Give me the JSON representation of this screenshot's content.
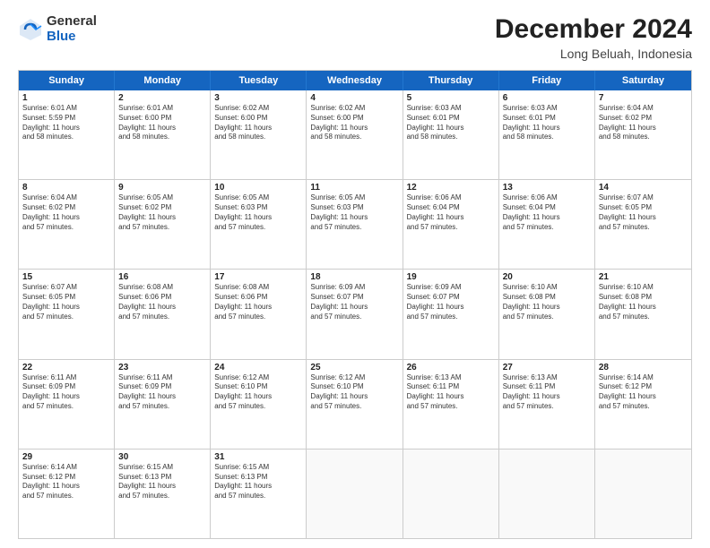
{
  "logo": {
    "general": "General",
    "blue": "Blue"
  },
  "title": "December 2024",
  "subtitle": "Long Beluah, Indonesia",
  "header_days": [
    "Sunday",
    "Monday",
    "Tuesday",
    "Wednesday",
    "Thursday",
    "Friday",
    "Saturday"
  ],
  "weeks": [
    [
      {
        "day": "1",
        "info": "Sunrise: 6:01 AM\nSunset: 5:59 PM\nDaylight: 11 hours\nand 58 minutes."
      },
      {
        "day": "2",
        "info": "Sunrise: 6:01 AM\nSunset: 6:00 PM\nDaylight: 11 hours\nand 58 minutes."
      },
      {
        "day": "3",
        "info": "Sunrise: 6:02 AM\nSunset: 6:00 PM\nDaylight: 11 hours\nand 58 minutes."
      },
      {
        "day": "4",
        "info": "Sunrise: 6:02 AM\nSunset: 6:00 PM\nDaylight: 11 hours\nand 58 minutes."
      },
      {
        "day": "5",
        "info": "Sunrise: 6:03 AM\nSunset: 6:01 PM\nDaylight: 11 hours\nand 58 minutes."
      },
      {
        "day": "6",
        "info": "Sunrise: 6:03 AM\nSunset: 6:01 PM\nDaylight: 11 hours\nand 58 minutes."
      },
      {
        "day": "7",
        "info": "Sunrise: 6:04 AM\nSunset: 6:02 PM\nDaylight: 11 hours\nand 58 minutes."
      }
    ],
    [
      {
        "day": "8",
        "info": "Sunrise: 6:04 AM\nSunset: 6:02 PM\nDaylight: 11 hours\nand 57 minutes."
      },
      {
        "day": "9",
        "info": "Sunrise: 6:05 AM\nSunset: 6:02 PM\nDaylight: 11 hours\nand 57 minutes."
      },
      {
        "day": "10",
        "info": "Sunrise: 6:05 AM\nSunset: 6:03 PM\nDaylight: 11 hours\nand 57 minutes."
      },
      {
        "day": "11",
        "info": "Sunrise: 6:05 AM\nSunset: 6:03 PM\nDaylight: 11 hours\nand 57 minutes."
      },
      {
        "day": "12",
        "info": "Sunrise: 6:06 AM\nSunset: 6:04 PM\nDaylight: 11 hours\nand 57 minutes."
      },
      {
        "day": "13",
        "info": "Sunrise: 6:06 AM\nSunset: 6:04 PM\nDaylight: 11 hours\nand 57 minutes."
      },
      {
        "day": "14",
        "info": "Sunrise: 6:07 AM\nSunset: 6:05 PM\nDaylight: 11 hours\nand 57 minutes."
      }
    ],
    [
      {
        "day": "15",
        "info": "Sunrise: 6:07 AM\nSunset: 6:05 PM\nDaylight: 11 hours\nand 57 minutes."
      },
      {
        "day": "16",
        "info": "Sunrise: 6:08 AM\nSunset: 6:06 PM\nDaylight: 11 hours\nand 57 minutes."
      },
      {
        "day": "17",
        "info": "Sunrise: 6:08 AM\nSunset: 6:06 PM\nDaylight: 11 hours\nand 57 minutes."
      },
      {
        "day": "18",
        "info": "Sunrise: 6:09 AM\nSunset: 6:07 PM\nDaylight: 11 hours\nand 57 minutes."
      },
      {
        "day": "19",
        "info": "Sunrise: 6:09 AM\nSunset: 6:07 PM\nDaylight: 11 hours\nand 57 minutes."
      },
      {
        "day": "20",
        "info": "Sunrise: 6:10 AM\nSunset: 6:08 PM\nDaylight: 11 hours\nand 57 minutes."
      },
      {
        "day": "21",
        "info": "Sunrise: 6:10 AM\nSunset: 6:08 PM\nDaylight: 11 hours\nand 57 minutes."
      }
    ],
    [
      {
        "day": "22",
        "info": "Sunrise: 6:11 AM\nSunset: 6:09 PM\nDaylight: 11 hours\nand 57 minutes."
      },
      {
        "day": "23",
        "info": "Sunrise: 6:11 AM\nSunset: 6:09 PM\nDaylight: 11 hours\nand 57 minutes."
      },
      {
        "day": "24",
        "info": "Sunrise: 6:12 AM\nSunset: 6:10 PM\nDaylight: 11 hours\nand 57 minutes."
      },
      {
        "day": "25",
        "info": "Sunrise: 6:12 AM\nSunset: 6:10 PM\nDaylight: 11 hours\nand 57 minutes."
      },
      {
        "day": "26",
        "info": "Sunrise: 6:13 AM\nSunset: 6:11 PM\nDaylight: 11 hours\nand 57 minutes."
      },
      {
        "day": "27",
        "info": "Sunrise: 6:13 AM\nSunset: 6:11 PM\nDaylight: 11 hours\nand 57 minutes."
      },
      {
        "day": "28",
        "info": "Sunrise: 6:14 AM\nSunset: 6:12 PM\nDaylight: 11 hours\nand 57 minutes."
      }
    ],
    [
      {
        "day": "29",
        "info": "Sunrise: 6:14 AM\nSunset: 6:12 PM\nDaylight: 11 hours\nand 57 minutes."
      },
      {
        "day": "30",
        "info": "Sunrise: 6:15 AM\nSunset: 6:13 PM\nDaylight: 11 hours\nand 57 minutes."
      },
      {
        "day": "31",
        "info": "Sunrise: 6:15 AM\nSunset: 6:13 PM\nDaylight: 11 hours\nand 57 minutes."
      },
      {
        "day": "",
        "info": ""
      },
      {
        "day": "",
        "info": ""
      },
      {
        "day": "",
        "info": ""
      },
      {
        "day": "",
        "info": ""
      }
    ]
  ]
}
